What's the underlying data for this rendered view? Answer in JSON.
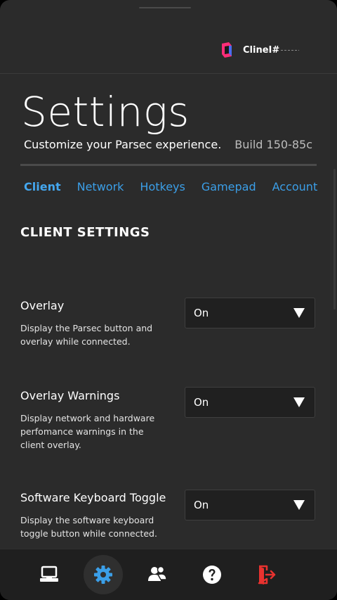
{
  "user": {
    "name": "ClineI#"
  },
  "header": {
    "title": "Settings",
    "subtitle": "Customize your Parsec experience.",
    "build": "Build 150-85c"
  },
  "tabs": [
    {
      "label": "Client",
      "active": true
    },
    {
      "label": "Network",
      "active": false
    },
    {
      "label": "Hotkeys",
      "active": false
    },
    {
      "label": "Gamepad",
      "active": false
    },
    {
      "label": "Account",
      "active": false
    }
  ],
  "section_title": "CLIENT SETTINGS",
  "settings": [
    {
      "label": "Overlay",
      "description": "Display the Parsec button and overlay while connected.",
      "value": "On"
    },
    {
      "label": "Overlay Warnings",
      "description": "Display network and hardware perfomance warnings in the client overlay.",
      "value": "On"
    },
    {
      "label": "Software Keyboard Toggle",
      "description": "Display the software keyboard toggle button while connected.",
      "value": "On"
    }
  ],
  "bottom_nav": [
    {
      "icon": "computer-icon",
      "active": false
    },
    {
      "icon": "gear-icon",
      "active": true
    },
    {
      "icon": "friends-icon",
      "active": false
    },
    {
      "icon": "help-icon",
      "active": false
    },
    {
      "icon": "logout-icon",
      "active": false
    }
  ],
  "colors": {
    "background": "#2b2b2b",
    "accent": "#3b9fe8",
    "bottom_nav": "#1f1f1f",
    "logout": "#e8322f",
    "brand_magenta": "#ff2d78"
  }
}
